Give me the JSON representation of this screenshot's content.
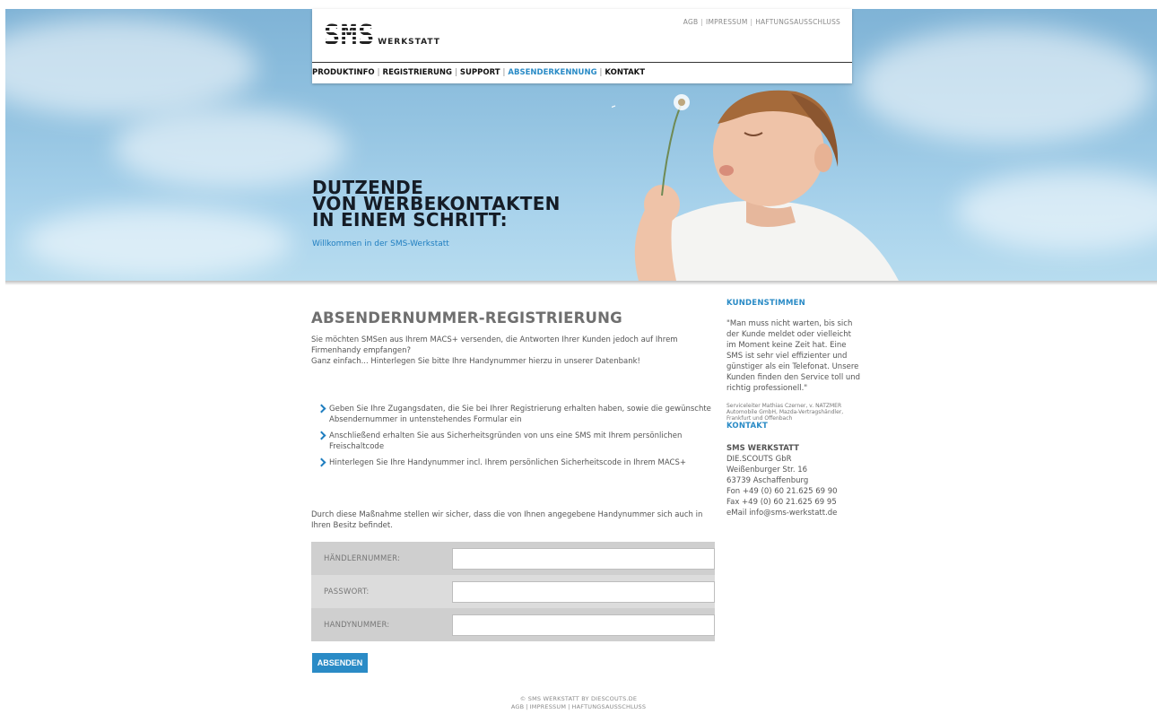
{
  "header": {
    "logo_sms": "SMS",
    "logo_werkstatt": "WERKSTATT",
    "top_links": [
      "AGB",
      "IMPRESSUM",
      "HAFTUNGSAUSSCHLUSS"
    ],
    "nav": [
      {
        "label": "PRODUKTINFO",
        "active": false
      },
      {
        "label": "REGISTRIERUNG",
        "active": false
      },
      {
        "label": "SUPPORT",
        "active": false
      },
      {
        "label": "ABSENDERKENNUNG",
        "active": true
      },
      {
        "label": "KONTAKT",
        "active": false
      }
    ]
  },
  "hero": {
    "title_lines": [
      "DUTZENDE",
      "VON WERBEKONTAKTEN",
      "IN EINEM SCHRITT:"
    ],
    "subtitle": "Willkommen in der SMS-Werkstatt"
  },
  "main": {
    "title": "ABSENDERNUMMER-REGISTRIERUNG",
    "intro_lines": [
      "Sie möchten SMSen aus Ihrem MACS+ versenden, die Antworten Ihrer Kunden jedoch auf Ihrem",
      "Firmenhandy empfangen?",
      "Ganz einfach... Hinterlegen Sie bitte Ihre Handynummer hierzu in unserer Datenbank!"
    ],
    "steps": [
      "Geben Sie Ihre Zugangsdaten, die Sie bei Ihrer Registrierung erhalten haben, sowie die gewünschte Absendernummer in untenstehendes Formular ein",
      "Anschließend erhalten Sie aus Sicherheitsgründen von uns eine SMS mit Ihrem persönlichen Freischaltcode",
      "Hinterlegen Sie Ihre Handynummer incl. Ihrem persönlichen Sicherheitscode in Ihrem MACS+"
    ],
    "notice": "Durch diese Maßnahme stellen wir sicher, dass die von Ihnen angegebene Handynummer sich auch in Ihren Besitz befindet.",
    "form": {
      "fields": [
        {
          "label": "HÄNDLERNUMMER:",
          "value": ""
        },
        {
          "label": "PASSWORT:",
          "value": ""
        },
        {
          "label": "HANDYNUMMER:",
          "value": ""
        }
      ],
      "submit_label": "ABSENDEN"
    }
  },
  "sidebar": {
    "testimonials_heading": "KUNDENSTIMMEN",
    "quote": "\"Man muss nicht warten, bis sich der Kunde meldet oder vielleicht im Moment keine Zeit hat. Eine SMS ist sehr viel effizienter und günstiger als ein Telefonat. Unsere Kunden finden den Service toll und richtig professionell.\"",
    "quote_source": "Serviceleiter Mathias Czerner, v. NATZMER Automobile GmbH, Mazda-Vertragshändler, Frankfurt und Offenbach",
    "contact_heading": "KONTAKT",
    "contact_company": "SMS WERKSTATT",
    "contact_lines": [
      "DIE.SCOUTS GbR",
      "Weißenburger Str. 16",
      "63739 Aschaffenburg",
      "Fon +49 (0) 60 21.625 69 90",
      "Fax +49 (0) 60 21.625 69 95",
      "eMail info@sms-werkstatt.de"
    ]
  },
  "footer": {
    "copyright": "© SMS WERKSTATT BY DIESCOUTS.DE",
    "links": [
      "AGB",
      "IMPRESSUM",
      "HAFTUNGSAUSSCHLUSS"
    ]
  },
  "colors": {
    "accent": "#2a8bc6",
    "sky": "#93c3e1",
    "form_bg": "#cfcfcf"
  }
}
